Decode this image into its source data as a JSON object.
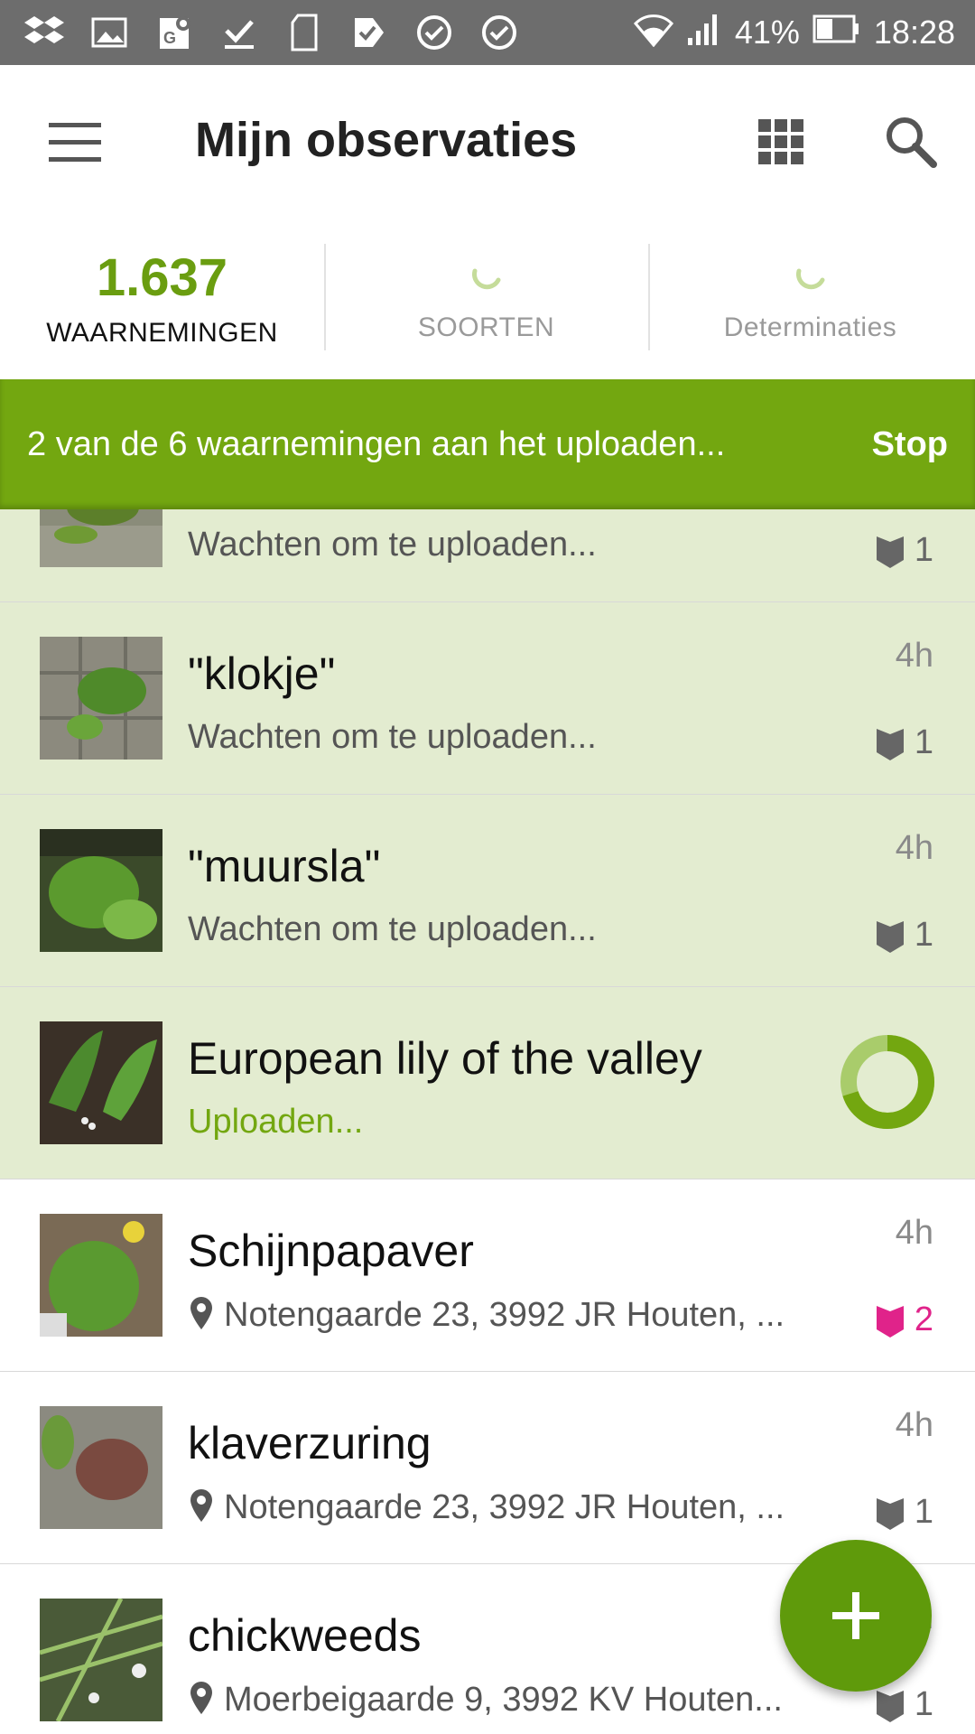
{
  "status_bar": {
    "battery": "41%",
    "time": "18:28",
    "icons": [
      "dropbox-icon",
      "image-icon",
      "maps-icon",
      "download-done-icon",
      "sd-card-icon",
      "checkmark-icon",
      "sync-icon",
      "sync-icon",
      "wifi-icon",
      "signal-icon",
      "battery-icon"
    ]
  },
  "app_bar": {
    "title": "Mijn observaties",
    "menu_icon": "hamburger-menu-icon",
    "grid_icon": "grid-view-icon",
    "search_icon": "search-icon"
  },
  "tabs": [
    {
      "count": "1.637",
      "label": "WAARNEMINGEN",
      "active": true
    },
    {
      "count": "",
      "label": "SOORTEN",
      "active": false
    },
    {
      "count": "",
      "label": "Determinaties",
      "active": false
    }
  ],
  "banner": {
    "text": "2 van de 6 waarnemingen aan het uploaden...",
    "stop_label": "Stop"
  },
  "observations": [
    {
      "title": "",
      "subtitle": "Wachten om te uploaden...",
      "time": "",
      "faves": "1",
      "state": "pending"
    },
    {
      "title": "\"klokje\"",
      "subtitle": "Wachten om te uploaden...",
      "time": "4h",
      "faves": "1",
      "state": "pending"
    },
    {
      "title": "\"muursla\"",
      "subtitle": "Wachten om te uploaden...",
      "time": "4h",
      "faves": "1",
      "state": "pending"
    },
    {
      "title": "European lily of the valley",
      "subtitle": "Uploaden...",
      "time": "",
      "faves": "",
      "state": "uploading",
      "progress": 0.7
    },
    {
      "title": "Schijnpapaver",
      "subtitle": "Notengaarde 23, 3992 JR Houten, ...",
      "time": "4h",
      "faves": "2",
      "state": "done",
      "liked": true
    },
    {
      "title": "klaverzuring",
      "subtitle": "Notengaarde 23, 3992 JR Houten, ...",
      "time": "4h",
      "faves": "1",
      "state": "done"
    },
    {
      "title": "chickweeds",
      "subtitle": "Moerbeigaarde 9, 3992 KV Houten...",
      "time": "4h",
      "faves": "1",
      "state": "done"
    }
  ],
  "fab": {
    "icon": "add-icon"
  },
  "colors": {
    "accent": "#73a710",
    "pending_bg": "#e3ecd0",
    "liked": "#e0238a",
    "status_bar": "#6d6d6d"
  }
}
